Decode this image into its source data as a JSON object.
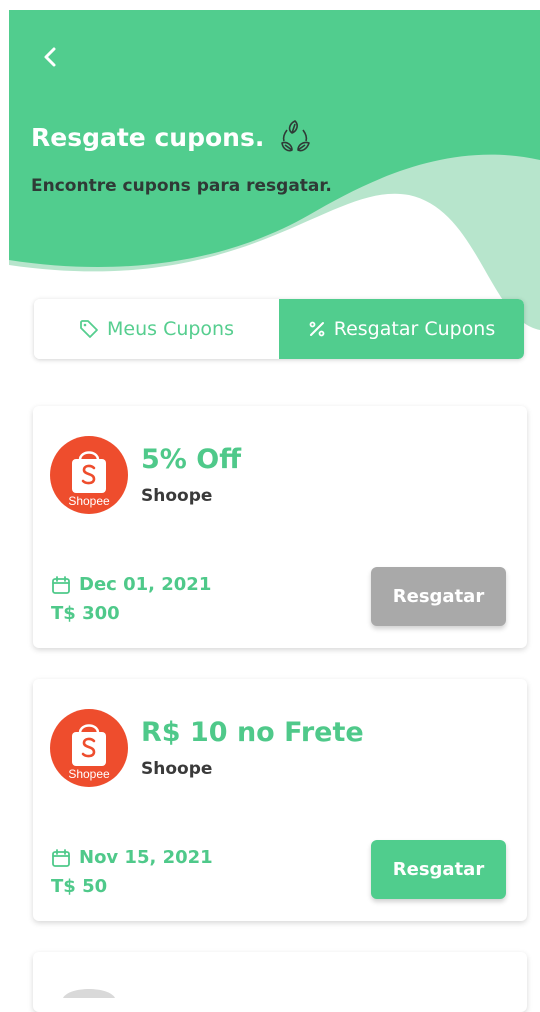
{
  "header": {
    "title": "Resgate cupons.",
    "subtitle": "Encontre cupons para resgatar.",
    "icons": {
      "back": "chevron-left-icon",
      "title": "recycle-leaves-icon"
    }
  },
  "tabs": [
    {
      "label": "Meus Cupons",
      "icon": "tag-icon",
      "active": false
    },
    {
      "label": "Resgatar Cupons",
      "icon": "percent-icon",
      "active": true
    }
  ],
  "coupons": [
    {
      "title": "5% Off",
      "store": "Shoope",
      "logo_text": "Shopee",
      "date": "Dec 01, 2021",
      "price": "T$ 300",
      "button": "Resgatar",
      "enabled": false
    },
    {
      "title": "R$ 10 no Frete",
      "store": "Shoope",
      "logo_text": "Shopee",
      "date": "Nov 15, 2021",
      "price": "T$ 50",
      "button": "Resgatar",
      "enabled": true
    }
  ],
  "colors": {
    "primary": "#51cd8e",
    "wave_light": "#b3e3c9",
    "disabled": "#a9a9a9",
    "shopee": "#ee4d2d"
  }
}
